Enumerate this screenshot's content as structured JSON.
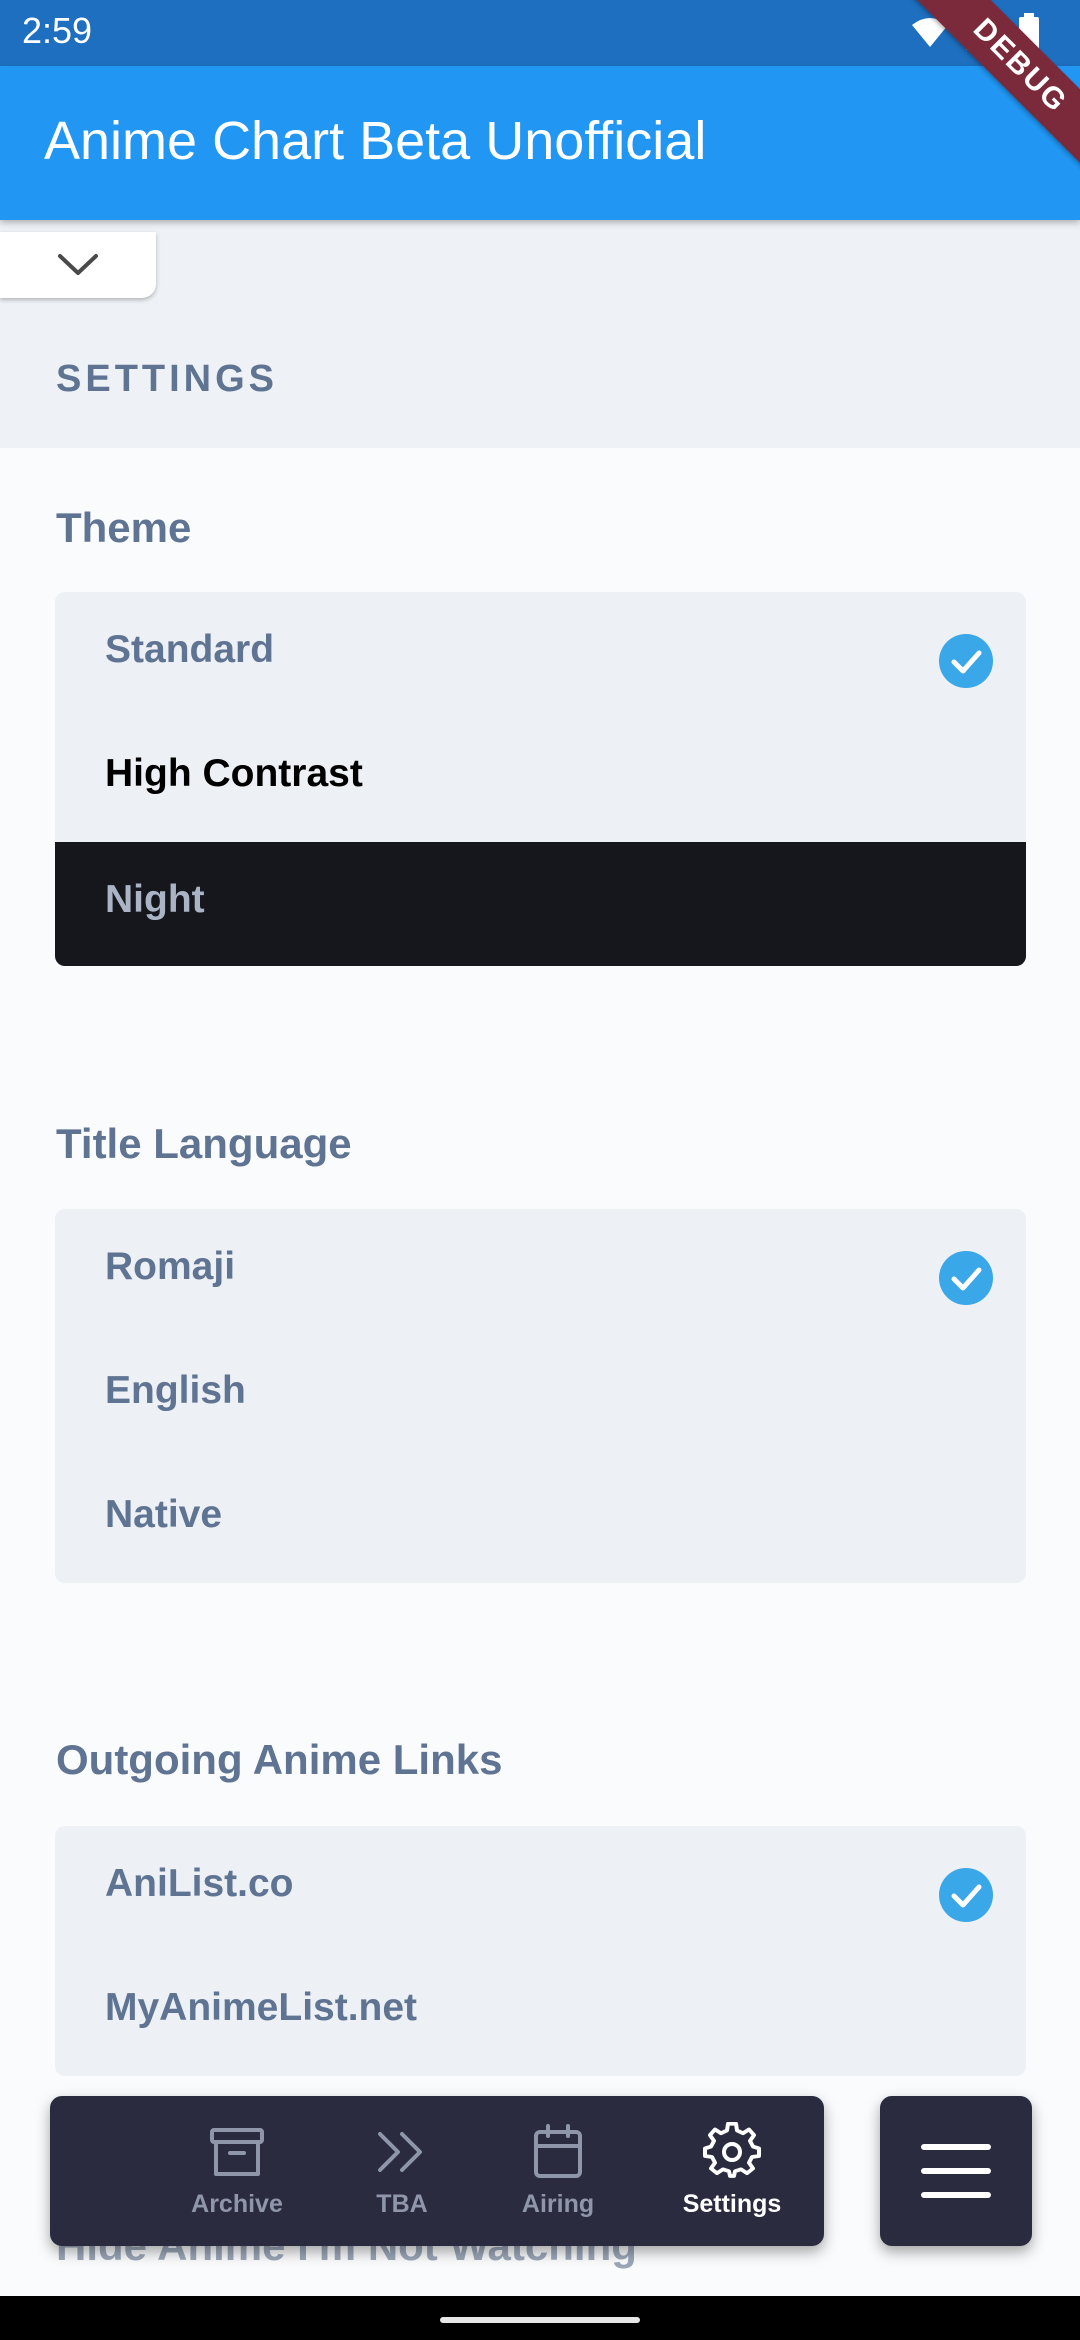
{
  "status_bar": {
    "time": "2:59"
  },
  "debug_label": "DEBUG",
  "app_bar": {
    "title": "Anime Chart Beta Unofficial"
  },
  "settings": {
    "heading": "SETTINGS",
    "sections": {
      "theme": {
        "title": "Theme",
        "options": [
          "Standard",
          "High Contrast",
          "Night"
        ],
        "selected": "Standard"
      },
      "title_language": {
        "title": "Title Language",
        "options": [
          "Romaji",
          "English",
          "Native"
        ],
        "selected": "Romaji"
      },
      "outgoing_links": {
        "title": "Outgoing Anime Links",
        "options": [
          "AniList.co",
          "MyAnimeList.net"
        ],
        "selected": "AniList.co"
      }
    },
    "partial_next_title": "Hide Anime I'm Not Watching"
  },
  "bottom_nav": {
    "items": [
      {
        "label": "Archive",
        "icon": "archive-icon"
      },
      {
        "label": "TBA",
        "icon": "double-chevron-right-icon"
      },
      {
        "label": "Airing",
        "icon": "calendar-icon"
      },
      {
        "label": "Settings",
        "icon": "gear-icon"
      }
    ],
    "active": "Settings"
  },
  "colors": {
    "app_bar": "#2196f3",
    "status_bar": "#1e6fbf",
    "check": "#3aa7e8",
    "nav_bg": "#2b2b40",
    "muted_text": "#5f7493",
    "night_row": "#15171c"
  }
}
